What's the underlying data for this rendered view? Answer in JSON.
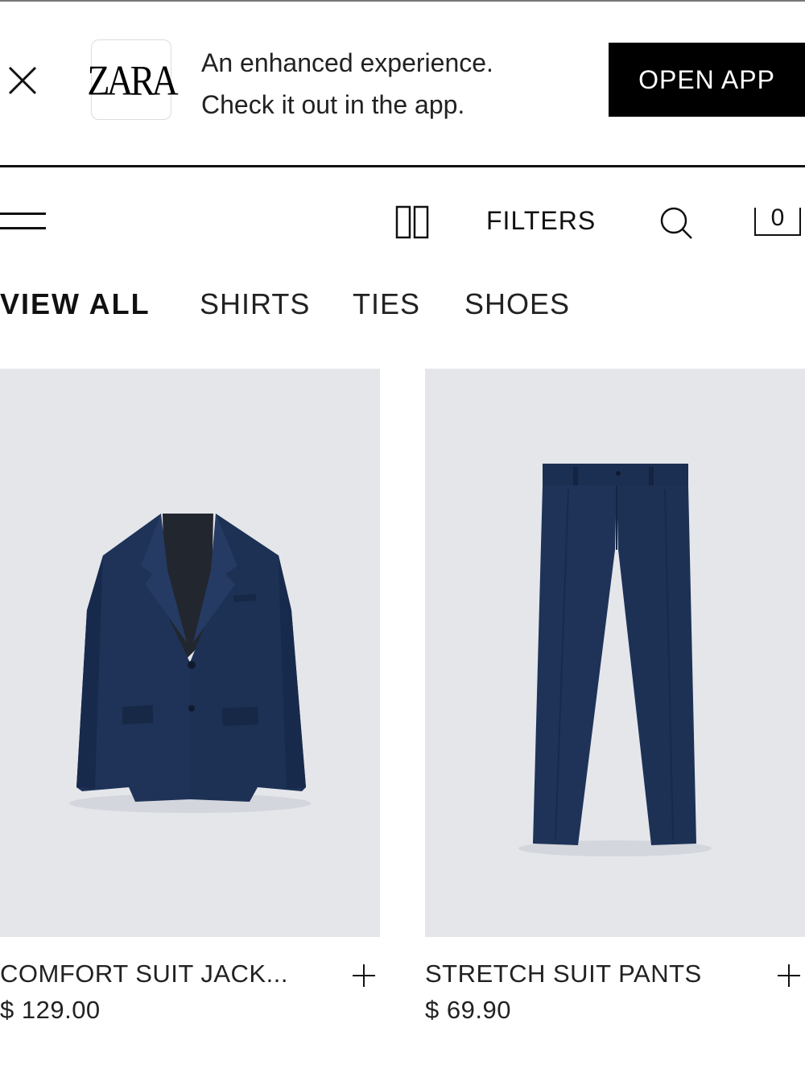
{
  "banner": {
    "close_icon": "close-icon",
    "app_name": "ZARA",
    "line1": "An enhanced experience.",
    "line2": "Check it out in the app.",
    "open_label": "OPEN APP"
  },
  "header": {
    "menu_icon": "hamburger-menu-icon",
    "grid_icon": "grid-view-icon",
    "filters_label": "FILTERS",
    "search_icon": "search-icon",
    "cart_icon": "shopping-bag-icon",
    "cart_count": "0"
  },
  "tabs": [
    {
      "label": "VIEW ALL",
      "active": true
    },
    {
      "label": "SHIRTS",
      "active": false
    },
    {
      "label": "TIES",
      "active": false
    },
    {
      "label": "SHOES",
      "active": false
    }
  ],
  "products": [
    {
      "name": "COMFORT SUIT JACK...",
      "price": "$ 129.00",
      "image": "navy suit jacket"
    },
    {
      "name": "STRETCH SUIT PANTS",
      "price": "$ 69.90",
      "image": "navy suit pants"
    }
  ],
  "colors": {
    "image_background": "#e4e6ea",
    "garment_navy": "#1f3358",
    "button_black": "#000000"
  }
}
